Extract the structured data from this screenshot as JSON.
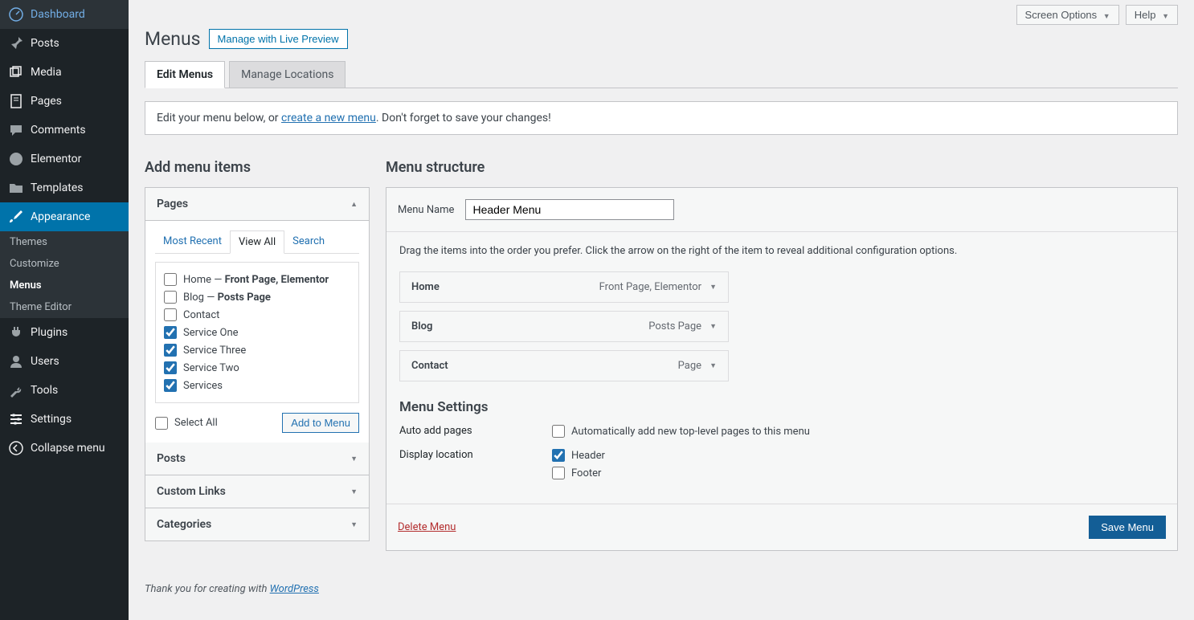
{
  "sidebar": {
    "items": [
      {
        "label": "Dashboard"
      },
      {
        "label": "Posts"
      },
      {
        "label": "Media"
      },
      {
        "label": "Pages"
      },
      {
        "label": "Comments"
      },
      {
        "label": "Elementor"
      },
      {
        "label": "Templates"
      },
      {
        "label": "Appearance"
      },
      {
        "label": "Plugins"
      },
      {
        "label": "Users"
      },
      {
        "label": "Tools"
      },
      {
        "label": "Settings"
      },
      {
        "label": "Collapse menu"
      }
    ],
    "sub": [
      "Themes",
      "Customize",
      "Menus",
      "Theme Editor"
    ]
  },
  "top": {
    "screen_options": "Screen Options",
    "help": "Help"
  },
  "header": {
    "title": "Menus",
    "btn": "Manage with Live Preview"
  },
  "tabs": {
    "edit": "Edit Menus",
    "locations": "Manage Locations"
  },
  "notice": {
    "pre": "Edit your menu below, or ",
    "link": "create a new menu",
    "post": ". Don't forget to save your changes!"
  },
  "left": {
    "title": "Add menu items",
    "pages": "Pages",
    "posts": "Posts",
    "custom": "Custom Links",
    "cats": "Categories",
    "inner": {
      "recent": "Most Recent",
      "viewall": "View All",
      "search": "Search"
    },
    "items": [
      {
        "label": "Home",
        "meta": " — ",
        "bold": "Front Page, Elementor",
        "checked": false
      },
      {
        "label": "Blog",
        "meta": " — ",
        "bold": "Posts Page",
        "checked": false
      },
      {
        "label": "Contact",
        "meta": "",
        "bold": "",
        "checked": false
      },
      {
        "label": "Service One",
        "meta": "",
        "bold": "",
        "checked": true
      },
      {
        "label": "Service Three",
        "meta": "",
        "bold": "",
        "checked": true
      },
      {
        "label": "Service Two",
        "meta": "",
        "bold": "",
        "checked": true
      },
      {
        "label": "Services",
        "meta": "",
        "bold": "",
        "checked": true
      }
    ],
    "select_all": "Select All",
    "add_btn": "Add to Menu"
  },
  "right": {
    "title": "Menu structure",
    "name_label": "Menu Name",
    "name_value": "Header Menu",
    "instruct": "Drag the items into the order you prefer. Click the arrow on the right of the item to reveal additional configuration options.",
    "items": [
      {
        "label": "Home",
        "type": "Front Page, Elementor"
      },
      {
        "label": "Blog",
        "type": "Posts Page"
      },
      {
        "label": "Contact",
        "type": "Page"
      }
    ],
    "settings_title": "Menu Settings",
    "auto_label": "Auto add pages",
    "auto_opt": "Automatically add new top-level pages to this menu",
    "loc_label": "Display location",
    "loc_header": "Header",
    "loc_footer": "Footer",
    "delete": "Delete Menu",
    "save": "Save Menu"
  },
  "footer": {
    "pre": "Thank you for creating with ",
    "link": "WordPress"
  }
}
